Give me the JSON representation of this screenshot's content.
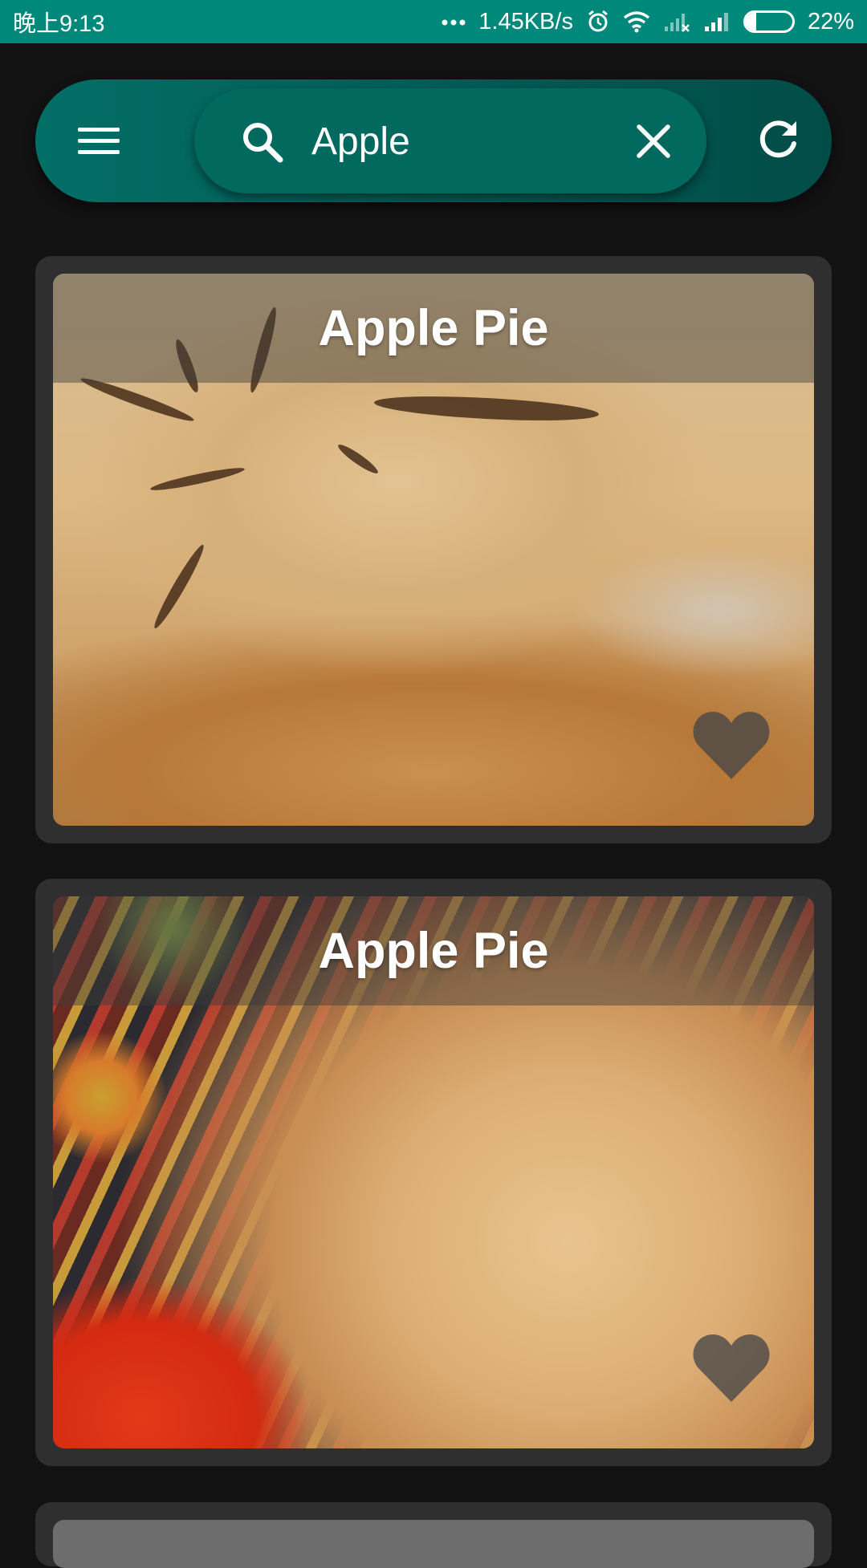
{
  "status_bar": {
    "time": "晚上9:13",
    "network_speed": "1.45KB/s",
    "battery_percent": "22%",
    "battery_level": 0.22,
    "icons": [
      "more-dots-icon",
      "alarm-icon",
      "wifi-icon",
      "signal-icon",
      "signal-icon",
      "battery-icon"
    ]
  },
  "toolbar": {
    "menu_icon": "hamburger-menu-icon",
    "search": {
      "value": "Apple",
      "placeholder": "",
      "icon": "search-icon",
      "clear_icon": "close-icon"
    },
    "refresh_icon": "refresh-icon"
  },
  "recipes": [
    {
      "title": "Apple Pie",
      "favorite_icon": "heart-icon"
    },
    {
      "title": "Apple Pie",
      "favorite_icon": "heart-icon"
    }
  ],
  "colors": {
    "status_bar": "#00897b",
    "toolbar": "#036e66",
    "search_box": "#02695f",
    "background": "#121212",
    "card": "#2f2f2f"
  }
}
